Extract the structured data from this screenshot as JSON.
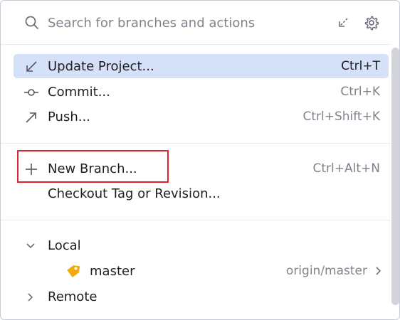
{
  "search": {
    "placeholder": "Search for branches and actions"
  },
  "actions": [
    {
      "label": "Update Project...",
      "shortcut": "Ctrl+T",
      "icon": "update-arrow-icon",
      "selected": true
    },
    {
      "label": "Commit...",
      "shortcut": "Ctrl+K",
      "icon": "commit-icon"
    },
    {
      "label": "Push...",
      "shortcut": "Ctrl+Shift+K",
      "icon": "push-arrow-icon"
    }
  ],
  "branch_actions": [
    {
      "label": "New Branch...",
      "shortcut": "Ctrl+Alt+N",
      "icon": "plus-icon"
    },
    {
      "label": "Checkout Tag or Revision...",
      "shortcut": ""
    }
  ],
  "tree": {
    "local": {
      "label": "Local",
      "expanded": true
    },
    "branches": [
      {
        "name": "master",
        "remote": "origin/master",
        "icon": "tag-icon"
      }
    ],
    "remote": {
      "label": "Remote",
      "expanded": false
    }
  },
  "colors": {
    "selected_bg": "#d5e0f9",
    "highlight_border": "#e0232e",
    "tag_icon": "#f2a90d"
  }
}
